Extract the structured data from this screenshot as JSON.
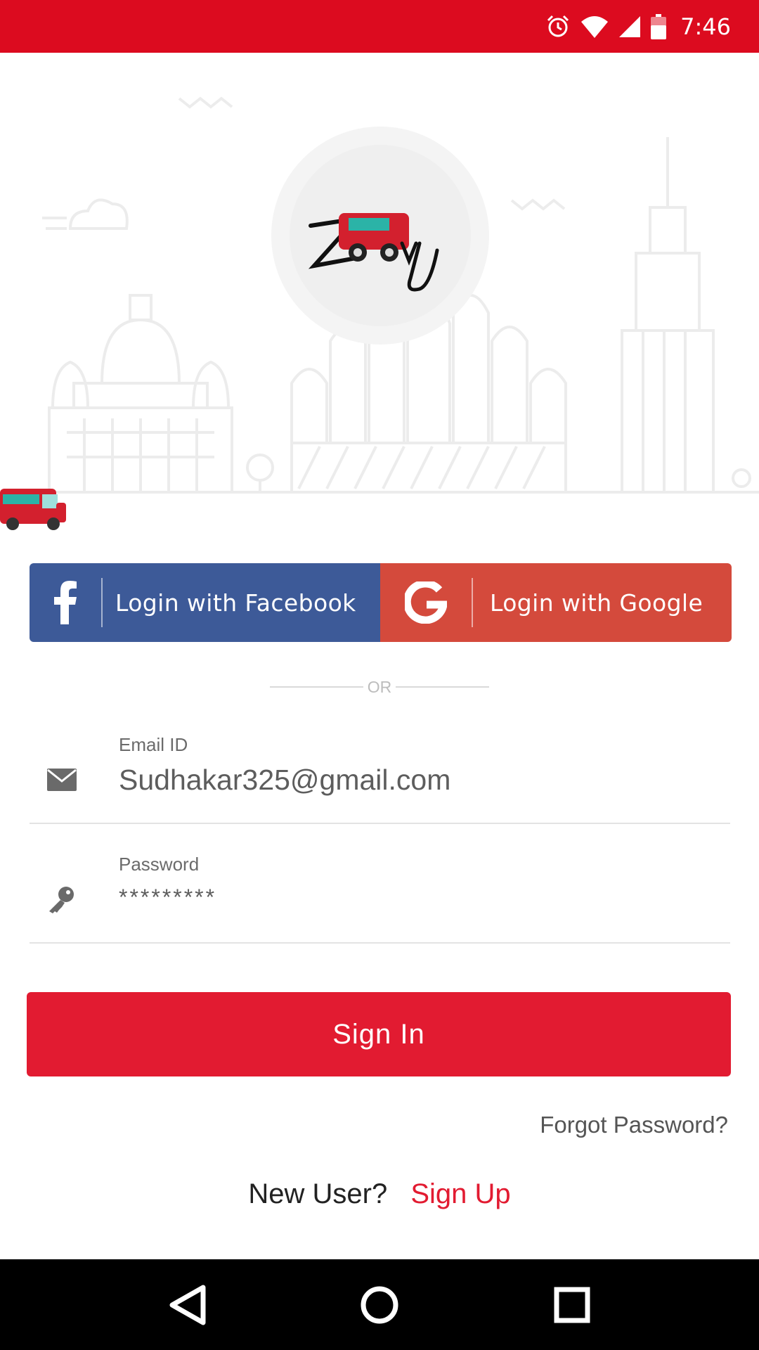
{
  "status_bar": {
    "time": "7:46",
    "icons": [
      "alarm-icon",
      "wifi-icon",
      "signal-icon",
      "battery-icon"
    ]
  },
  "brand": {
    "logo_text": "Zoozy"
  },
  "social": {
    "facebook_label": "Login with Facebook",
    "google_label": "Login with Google",
    "facebook_color": "#3d5a98",
    "google_color": "#d44a3c"
  },
  "divider": {
    "text": "OR"
  },
  "form": {
    "email": {
      "label": "Email ID",
      "value": "Sudhakar325@gmail.com"
    },
    "password": {
      "label": "Password",
      "value": "*********"
    }
  },
  "actions": {
    "sign_in": "Sign In",
    "forgot_password": "Forgot Password?",
    "new_user": "New User?",
    "sign_up": "Sign Up"
  },
  "colors": {
    "accent": "#e21b31",
    "status_bar": "#dc0b1f"
  },
  "nav_bar": {
    "icons": [
      "back-icon",
      "home-icon",
      "recents-icon"
    ]
  }
}
